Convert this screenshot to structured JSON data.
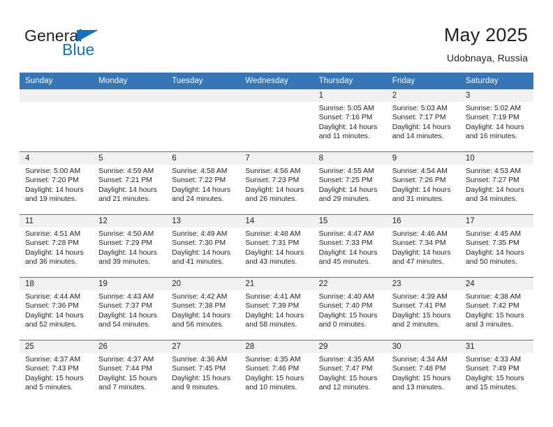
{
  "brand": {
    "name_top": "General",
    "name_bottom": "Blue",
    "color_text": "#231f20",
    "color_blue": "#1272c0",
    "triangle_icon": "triangle-icon"
  },
  "header": {
    "title": "May 2025",
    "subtitle": "Udobnaya, Russia"
  },
  "theme": {
    "header_bg": "#3676b6",
    "header_text": "#ffffff",
    "daynum_bg": "#f1f1f1",
    "row_border": "#3676b6",
    "body_text": "#221f1f"
  },
  "weekdays": [
    "Sunday",
    "Monday",
    "Tuesday",
    "Wednesday",
    "Thursday",
    "Friday",
    "Saturday"
  ],
  "weeks": [
    [
      {
        "day": "",
        "empty": true,
        "sunrise": "",
        "sunset": "",
        "daylight1": "",
        "daylight2": ""
      },
      {
        "day": "",
        "empty": true,
        "sunrise": "",
        "sunset": "",
        "daylight1": "",
        "daylight2": ""
      },
      {
        "day": "",
        "empty": true,
        "sunrise": "",
        "sunset": "",
        "daylight1": "",
        "daylight2": ""
      },
      {
        "day": "",
        "empty": true,
        "sunrise": "",
        "sunset": "",
        "daylight1": "",
        "daylight2": ""
      },
      {
        "day": "1",
        "sunrise": "Sunrise: 5:05 AM",
        "sunset": "Sunset: 7:16 PM",
        "daylight1": "Daylight: 14 hours",
        "daylight2": "and 11 minutes."
      },
      {
        "day": "2",
        "sunrise": "Sunrise: 5:03 AM",
        "sunset": "Sunset: 7:17 PM",
        "daylight1": "Daylight: 14 hours",
        "daylight2": "and 14 minutes."
      },
      {
        "day": "3",
        "sunrise": "Sunrise: 5:02 AM",
        "sunset": "Sunset: 7:19 PM",
        "daylight1": "Daylight: 14 hours",
        "daylight2": "and 16 minutes."
      }
    ],
    [
      {
        "day": "4",
        "sunrise": "Sunrise: 5:00 AM",
        "sunset": "Sunset: 7:20 PM",
        "daylight1": "Daylight: 14 hours",
        "daylight2": "and 19 minutes."
      },
      {
        "day": "5",
        "sunrise": "Sunrise: 4:59 AM",
        "sunset": "Sunset: 7:21 PM",
        "daylight1": "Daylight: 14 hours",
        "daylight2": "and 21 minutes."
      },
      {
        "day": "6",
        "sunrise": "Sunrise: 4:58 AM",
        "sunset": "Sunset: 7:22 PM",
        "daylight1": "Daylight: 14 hours",
        "daylight2": "and 24 minutes."
      },
      {
        "day": "7",
        "sunrise": "Sunrise: 4:56 AM",
        "sunset": "Sunset: 7:23 PM",
        "daylight1": "Daylight: 14 hours",
        "daylight2": "and 26 minutes."
      },
      {
        "day": "8",
        "sunrise": "Sunrise: 4:55 AM",
        "sunset": "Sunset: 7:25 PM",
        "daylight1": "Daylight: 14 hours",
        "daylight2": "and 29 minutes."
      },
      {
        "day": "9",
        "sunrise": "Sunrise: 4:54 AM",
        "sunset": "Sunset: 7:26 PM",
        "daylight1": "Daylight: 14 hours",
        "daylight2": "and 31 minutes."
      },
      {
        "day": "10",
        "sunrise": "Sunrise: 4:53 AM",
        "sunset": "Sunset: 7:27 PM",
        "daylight1": "Daylight: 14 hours",
        "daylight2": "and 34 minutes."
      }
    ],
    [
      {
        "day": "11",
        "sunrise": "Sunrise: 4:51 AM",
        "sunset": "Sunset: 7:28 PM",
        "daylight1": "Daylight: 14 hours",
        "daylight2": "and 36 minutes."
      },
      {
        "day": "12",
        "sunrise": "Sunrise: 4:50 AM",
        "sunset": "Sunset: 7:29 PM",
        "daylight1": "Daylight: 14 hours",
        "daylight2": "and 39 minutes."
      },
      {
        "day": "13",
        "sunrise": "Sunrise: 4:49 AM",
        "sunset": "Sunset: 7:30 PM",
        "daylight1": "Daylight: 14 hours",
        "daylight2": "and 41 minutes."
      },
      {
        "day": "14",
        "sunrise": "Sunrise: 4:48 AM",
        "sunset": "Sunset: 7:31 PM",
        "daylight1": "Daylight: 14 hours",
        "daylight2": "and 43 minutes."
      },
      {
        "day": "15",
        "sunrise": "Sunrise: 4:47 AM",
        "sunset": "Sunset: 7:33 PM",
        "daylight1": "Daylight: 14 hours",
        "daylight2": "and 45 minutes."
      },
      {
        "day": "16",
        "sunrise": "Sunrise: 4:46 AM",
        "sunset": "Sunset: 7:34 PM",
        "daylight1": "Daylight: 14 hours",
        "daylight2": "and 47 minutes."
      },
      {
        "day": "17",
        "sunrise": "Sunrise: 4:45 AM",
        "sunset": "Sunset: 7:35 PM",
        "daylight1": "Daylight: 14 hours",
        "daylight2": "and 50 minutes."
      }
    ],
    [
      {
        "day": "18",
        "sunrise": "Sunrise: 4:44 AM",
        "sunset": "Sunset: 7:36 PM",
        "daylight1": "Daylight: 14 hours",
        "daylight2": "and 52 minutes."
      },
      {
        "day": "19",
        "sunrise": "Sunrise: 4:43 AM",
        "sunset": "Sunset: 7:37 PM",
        "daylight1": "Daylight: 14 hours",
        "daylight2": "and 54 minutes."
      },
      {
        "day": "20",
        "sunrise": "Sunrise: 4:42 AM",
        "sunset": "Sunset: 7:38 PM",
        "daylight1": "Daylight: 14 hours",
        "daylight2": "and 56 minutes."
      },
      {
        "day": "21",
        "sunrise": "Sunrise: 4:41 AM",
        "sunset": "Sunset: 7:39 PM",
        "daylight1": "Daylight: 14 hours",
        "daylight2": "and 58 minutes."
      },
      {
        "day": "22",
        "sunrise": "Sunrise: 4:40 AM",
        "sunset": "Sunset: 7:40 PM",
        "daylight1": "Daylight: 15 hours",
        "daylight2": "and 0 minutes."
      },
      {
        "day": "23",
        "sunrise": "Sunrise: 4:39 AM",
        "sunset": "Sunset: 7:41 PM",
        "daylight1": "Daylight: 15 hours",
        "daylight2": "and 2 minutes."
      },
      {
        "day": "24",
        "sunrise": "Sunrise: 4:38 AM",
        "sunset": "Sunset: 7:42 PM",
        "daylight1": "Daylight: 15 hours",
        "daylight2": "and 3 minutes."
      }
    ],
    [
      {
        "day": "25",
        "sunrise": "Sunrise: 4:37 AM",
        "sunset": "Sunset: 7:43 PM",
        "daylight1": "Daylight: 15 hours",
        "daylight2": "and 5 minutes."
      },
      {
        "day": "26",
        "sunrise": "Sunrise: 4:37 AM",
        "sunset": "Sunset: 7:44 PM",
        "daylight1": "Daylight: 15 hours",
        "daylight2": "and 7 minutes."
      },
      {
        "day": "27",
        "sunrise": "Sunrise: 4:36 AM",
        "sunset": "Sunset: 7:45 PM",
        "daylight1": "Daylight: 15 hours",
        "daylight2": "and 9 minutes."
      },
      {
        "day": "28",
        "sunrise": "Sunrise: 4:35 AM",
        "sunset": "Sunset: 7:46 PM",
        "daylight1": "Daylight: 15 hours",
        "daylight2": "and 10 minutes."
      },
      {
        "day": "29",
        "sunrise": "Sunrise: 4:35 AM",
        "sunset": "Sunset: 7:47 PM",
        "daylight1": "Daylight: 15 hours",
        "daylight2": "and 12 minutes."
      },
      {
        "day": "30",
        "sunrise": "Sunrise: 4:34 AM",
        "sunset": "Sunset: 7:48 PM",
        "daylight1": "Daylight: 15 hours",
        "daylight2": "and 13 minutes."
      },
      {
        "day": "31",
        "sunrise": "Sunrise: 4:33 AM",
        "sunset": "Sunset: 7:49 PM",
        "daylight1": "Daylight: 15 hours",
        "daylight2": "and 15 minutes."
      }
    ]
  ]
}
